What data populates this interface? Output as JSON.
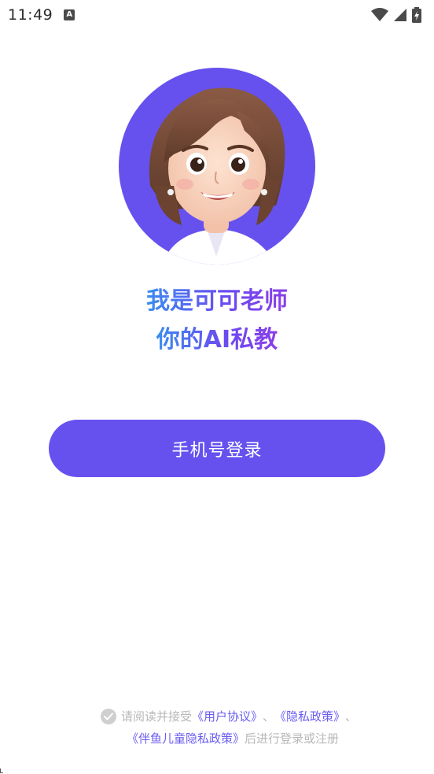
{
  "status_bar": {
    "time": "11:49",
    "notification_icon": "text-a-notification-icon",
    "wifi_icon": "wifi-icon",
    "signal_icon": "cell-signal-icon",
    "battery_icon": "battery-charging-icon"
  },
  "hero": {
    "avatar_icon": "teacher-avatar-illustration",
    "avatar_bg_color": "#6651ef",
    "title_line_1": "我是可可老师",
    "title_line_2": "你的AI私教"
  },
  "login": {
    "button_label": "手机号登录",
    "button_color": "#6651ef"
  },
  "agreement": {
    "check_icon": "check-circle-icon",
    "prefix": "请阅读并接受",
    "user_agreement": "《用户协议》",
    "separator_1": "、",
    "privacy_policy": "《隐私政策》",
    "separator_2": "、",
    "child_privacy_policy": "《伴鱼儿童隐私政策》",
    "suffix": "后进行登录或注册",
    "link_color": "#6a5cf0"
  }
}
